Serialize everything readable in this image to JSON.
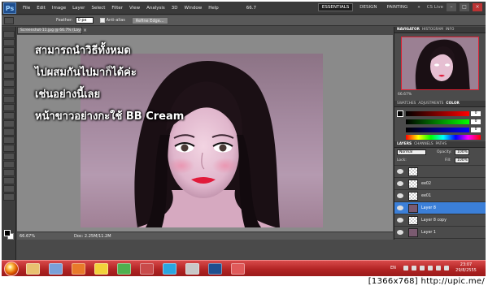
{
  "app": {
    "logo": "Ps",
    "menu": [
      "File",
      "Edit",
      "Image",
      "Layer",
      "Select",
      "Filter",
      "View",
      "Analysis",
      "3D",
      "Window",
      "Help"
    ],
    "zoom_dropdown": "66.7",
    "workspaces": [
      "ESSENTIALS",
      "DESIGN",
      "PAINTING"
    ],
    "workspaces_more": "»",
    "cs_live": "CS Live"
  },
  "options_bar": {
    "feather_label": "Feather:",
    "feather_value": "0 px",
    "antialias_label": "Anti-alias",
    "refine_edge": "Refine Edge..."
  },
  "document": {
    "tab_title": "Screenshot-11.jpg @ 66.7% (Layer 8, RGB/8#)",
    "close": "×",
    "overlay_lines": [
      "สามารถนำวิธีทั้งหมด",
      "ไปผสมกันไปมาก็ได้ค่ะ",
      "เช่นอย่างนี้เลย",
      "หน้าขาวอย่างกะใช้ BB Cream"
    ],
    "status_zoom": "66.67%",
    "status_doc": "Doc: 2.25M/11.2M"
  },
  "panels": {
    "navigator_tabs": [
      "NAVIGATOR",
      "HISTOGRAM",
      "INFO"
    ],
    "navigator_zoom": "66.67%",
    "color_tabs": [
      "SWATCHES",
      "ADJUSTMENTS",
      "COLOR"
    ],
    "color_values": [
      "0",
      "0",
      "0"
    ],
    "layers_tabs": [
      "LAYERS",
      "CHANNELS",
      "PATHS"
    ],
    "blend_mode": "Normal",
    "opacity_label": "Opacity:",
    "opacity_value": "100%",
    "lock_label": "Lock:",
    "fill_label": "Fill:",
    "fill_value": "100%",
    "layers": [
      {
        "name": "",
        "selected": false,
        "kind": "transparent"
      },
      {
        "name": "ee02",
        "selected": false,
        "kind": "transparent"
      },
      {
        "name": "ee01",
        "selected": false,
        "kind": "transparent"
      },
      {
        "name": "Layer 8",
        "selected": true,
        "kind": "image"
      },
      {
        "name": "Layer 8 copy",
        "selected": false,
        "kind": "transparent"
      },
      {
        "name": "Layer 1",
        "selected": false,
        "kind": "image"
      }
    ]
  },
  "taskbar": {
    "lang": "EN",
    "clock_time": "23:07",
    "clock_date": "29/8/2555"
  },
  "watermark": "[1366x768] http://upic.me/"
}
